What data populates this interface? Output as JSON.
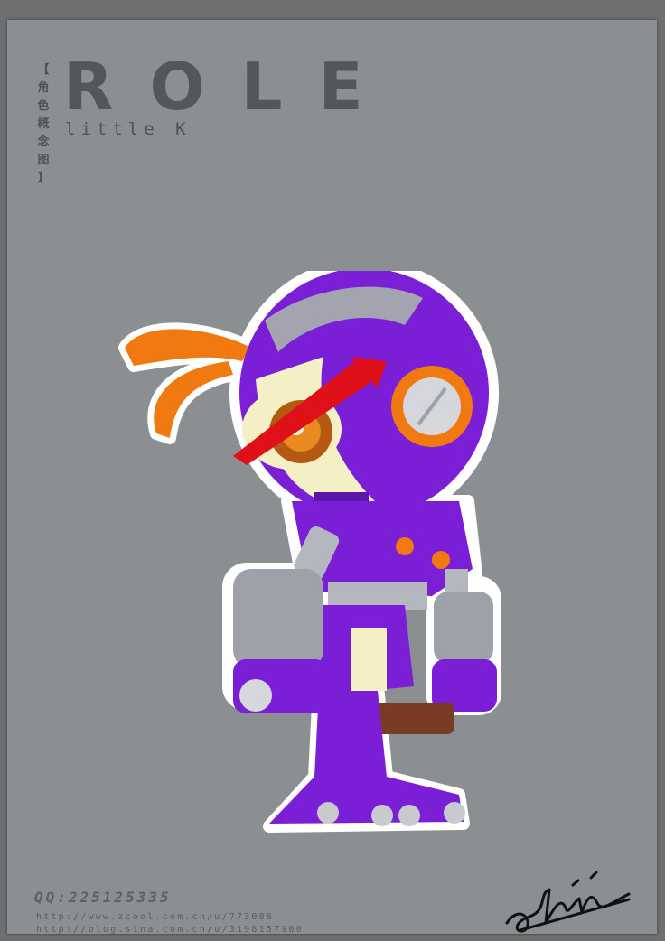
{
  "title": "ROLE",
  "subtitle": "little K",
  "vertical_label": [
    "【",
    "角",
    "色",
    "概",
    "念",
    "图",
    "】"
  ],
  "qq": "QQ:225125335",
  "urls": [
    "http://www.zcool.com.cn/u/773086",
    "http://blog.sina.com.cn/u/3198157900"
  ],
  "colors": {
    "background": "#8c8f91",
    "robot_purple": "#7a1fd6",
    "accent_orange": "#f07a10",
    "visor_red": "#e0101a"
  }
}
